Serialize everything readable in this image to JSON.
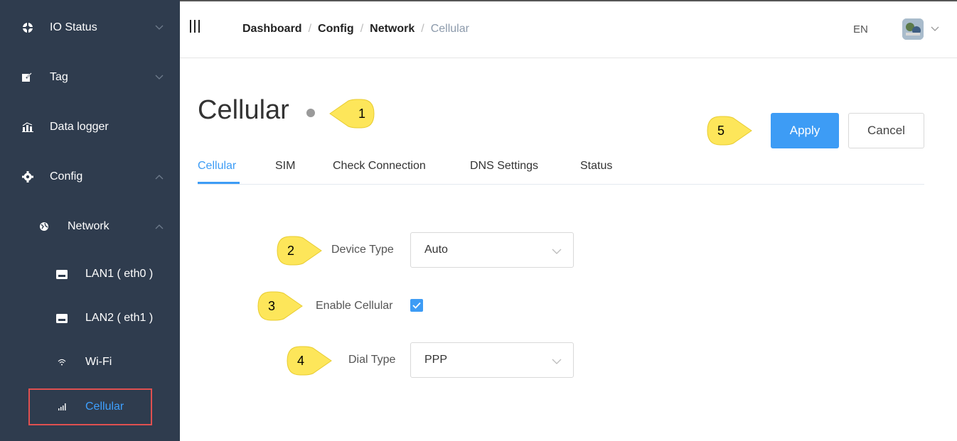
{
  "sidebar": {
    "items": [
      {
        "label": "IO Status",
        "icon": "io-status-icon"
      },
      {
        "label": "Tag",
        "icon": "tag-icon"
      },
      {
        "label": "Data logger",
        "icon": "data-logger-icon"
      },
      {
        "label": "Config",
        "icon": "gear-icon"
      },
      {
        "label": "Network",
        "icon": "network-icon"
      },
      {
        "label": "LAN1 ( eth0 )",
        "icon": "lan-icon"
      },
      {
        "label": "LAN2 ( eth1 )",
        "icon": "lan-icon"
      },
      {
        "label": "Wi-Fi",
        "icon": "wifi-icon"
      },
      {
        "label": "Cellular",
        "icon": "signal-icon"
      }
    ]
  },
  "header": {
    "breadcrumb": [
      "Dashboard",
      "Config",
      "Network"
    ],
    "breadcrumb_current": "Cellular",
    "separator": "/",
    "language": "EN"
  },
  "main": {
    "title": "Cellular",
    "apply_label": "Apply",
    "cancel_label": "Cancel",
    "tabs": [
      "Cellular",
      "SIM",
      "Check Connection",
      "DNS Settings",
      "Status"
    ],
    "form": {
      "device_type_label": "Device Type",
      "device_type_value": "Auto",
      "enable_cellular_label": "Enable Cellular",
      "enable_cellular_checked": true,
      "dial_type_label": "Dial Type",
      "dial_type_value": "PPP"
    }
  },
  "callouts": [
    "1",
    "2",
    "3",
    "4",
    "5"
  ],
  "colors": {
    "sidebar_bg": "#2f3c4e",
    "accent": "#3d9cf5",
    "callout_fill": "#fde65a",
    "highlight_border": "#e05050"
  }
}
